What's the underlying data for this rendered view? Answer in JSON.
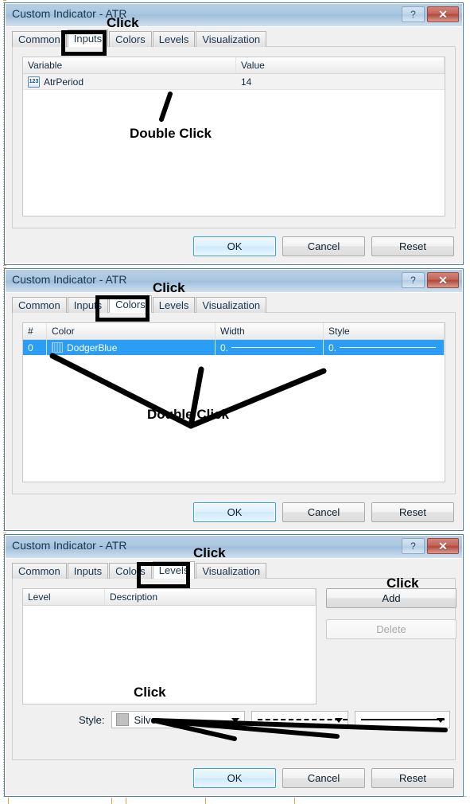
{
  "window": {
    "title": "Custom Indicator - ATR",
    "help_button": "?",
    "close_button": "✕"
  },
  "tabs": [
    {
      "label": "Common"
    },
    {
      "label": "Inputs"
    },
    {
      "label": "Colors"
    },
    {
      "label": "Levels"
    },
    {
      "label": "Visualization"
    }
  ],
  "buttons": {
    "ok": "OK",
    "cancel": "Cancel",
    "reset": "Reset"
  },
  "panel_inputs": {
    "active_tab": "Inputs",
    "columns": [
      "Variable",
      "Value"
    ],
    "rows": [
      {
        "icon": "number-123-icon",
        "variable": "AtrPeriod",
        "value": "14"
      }
    ],
    "annotations": [
      {
        "text": "Click",
        "target": "tab-inputs"
      },
      {
        "text": "Double Click",
        "target": "row-atrperiod"
      }
    ]
  },
  "panel_colors": {
    "active_tab": "Colors",
    "columns": [
      "#",
      "Color",
      "Width",
      "Style"
    ],
    "rows": [
      {
        "index": "0",
        "color_name": "DodgerBlue",
        "color_hex": "#1E90FF",
        "width_value": "0.",
        "style_value": "0."
      }
    ],
    "annotations": [
      {
        "text": "Click",
        "target": "tab-colors"
      },
      {
        "text": "Double Click",
        "target": "row-color-cells"
      }
    ]
  },
  "panel_levels": {
    "active_tab": "Levels",
    "columns": [
      "Level",
      "Description"
    ],
    "rows": [],
    "add_button": "Add",
    "delete_button": "Delete",
    "style_label": "Style:",
    "style_color_name": "Silver",
    "style_color_hex": "#C0C0C0",
    "style_line_dash": "dashed-line-sample",
    "style_line_solid": "solid-line-sample",
    "annotations": [
      {
        "text": "Click",
        "target": "tab-levels"
      },
      {
        "text": "Click",
        "target": "add-button"
      },
      {
        "text": "Click",
        "target": "style-combos"
      }
    ]
  },
  "colors": {
    "selection_blue": "#2A9DF4",
    "titlebar_blue": "#AAC6E0",
    "dialog_face": "#F0F0F0",
    "accent_border": "#4B7EA8"
  }
}
